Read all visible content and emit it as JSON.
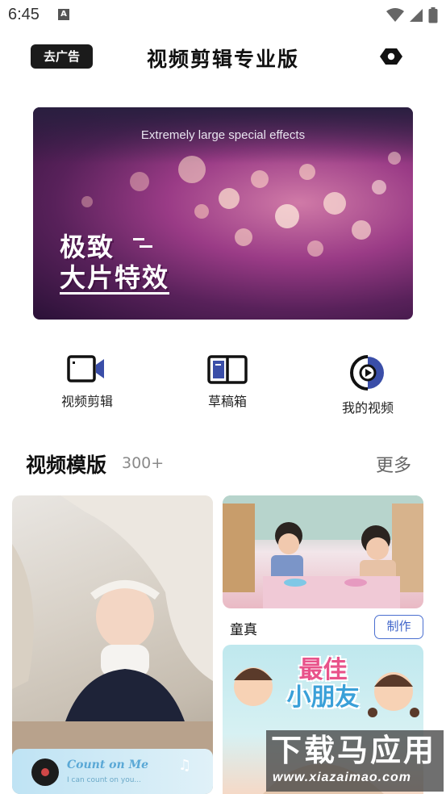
{
  "status_bar": {
    "time": "6:45",
    "notification_letter": "A"
  },
  "header": {
    "ad_button_label": "去广告",
    "title": "视频剪辑专业版",
    "settings_icon": "gear-icon"
  },
  "banner": {
    "subtitle": "Extremely large special effects",
    "title_line1": "极致",
    "title_line2": "大片特效"
  },
  "actions": [
    {
      "label": "视频剪辑",
      "icon": "video-camera-icon"
    },
    {
      "label": "草稿箱",
      "icon": "drafts-book-icon"
    },
    {
      "label": "我的视频",
      "icon": "play-circle-icon"
    }
  ],
  "templates": {
    "title": "视频模版",
    "count": "300+",
    "more_label": "更多",
    "cards": [
      {
        "music_title": "Count on Me",
        "music_lyric": "I can count on you..."
      },
      {
        "name": "童真",
        "action_label": "制作"
      },
      {
        "title_line1": "最佳",
        "title_line2": "小朋友"
      }
    ]
  },
  "watermark": {
    "main": "下载马应用",
    "url": "www.xiazaimao.com"
  },
  "colors": {
    "accent_blue": "#3e63c9",
    "count_gray": "#8a8a8a",
    "dark_button": "#1b1b1b"
  }
}
